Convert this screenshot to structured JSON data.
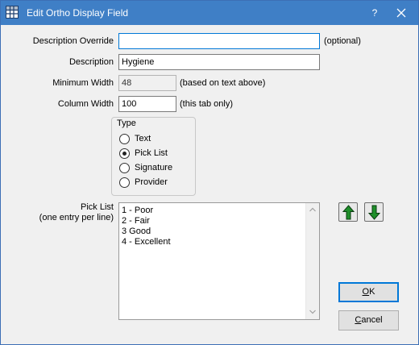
{
  "window": {
    "title": "Edit Ortho Display Field",
    "help_label": "?",
    "app_icon": "grid-app-icon",
    "title_bar_color": "#3f7fc6"
  },
  "form": {
    "description_override": {
      "label": "Description Override",
      "value": "",
      "hint": "(optional)"
    },
    "description": {
      "label": "Description",
      "value": "Hygiene"
    },
    "minimum_width": {
      "label": "Minimum Width",
      "value": "48",
      "hint": "(based on text above)"
    },
    "column_width": {
      "label": "Column Width",
      "value": "100",
      "hint": "(this tab only)"
    }
  },
  "type_group": {
    "title": "Type",
    "selected": "Pick List",
    "options": [
      "Text",
      "Pick List",
      "Signature",
      "Provider"
    ]
  },
  "pick_list": {
    "label_line1": "Pick List",
    "label_line2": "(one entry per line)",
    "entries": [
      "1 - Poor",
      "2 - Fair",
      "3 Good",
      "4 - Excellent"
    ]
  },
  "buttons": {
    "move_up": "arrow-up-icon",
    "move_down": "arrow-down-icon",
    "ok_mnemonic": "O",
    "ok_rest": "K",
    "cancel_mnemonic": "C",
    "cancel_rest": "ancel"
  },
  "colors": {
    "arrow_green": "#1f8f2a",
    "focus_border": "#0078d7"
  }
}
